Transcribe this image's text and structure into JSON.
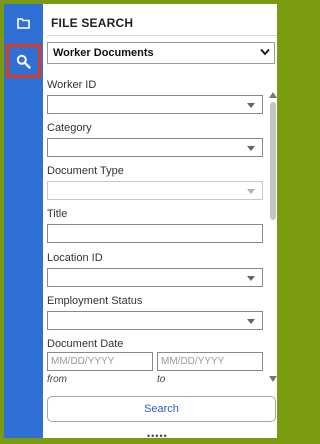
{
  "sidebar": {
    "items": [
      {
        "icon": "folder-icon"
      },
      {
        "icon": "search-icon",
        "active": true
      }
    ],
    "colors": {
      "background": "#2f6fd6",
      "active_outline": "#d93c1f"
    }
  },
  "panel": {
    "title": "FILE SEARCH",
    "document_type_select": {
      "value": "Worker Documents"
    },
    "fields": {
      "worker_id": {
        "label": "Worker ID",
        "value": ""
      },
      "category": {
        "label": "Category",
        "value": ""
      },
      "document_type": {
        "label": "Document Type",
        "value": ""
      },
      "title": {
        "label": "Title",
        "value": ""
      },
      "location_id": {
        "label": "Location ID",
        "value": ""
      },
      "employment_status": {
        "label": "Employment Status",
        "value": ""
      }
    },
    "document_date": {
      "label": "Document Date",
      "from": {
        "placeholder": "MM/DD/YYYY",
        "hint": "from"
      },
      "to": {
        "placeholder": "MM/DD/YYYY",
        "hint": "to"
      }
    },
    "search_button": "Search",
    "more_indicator": "•••••"
  }
}
